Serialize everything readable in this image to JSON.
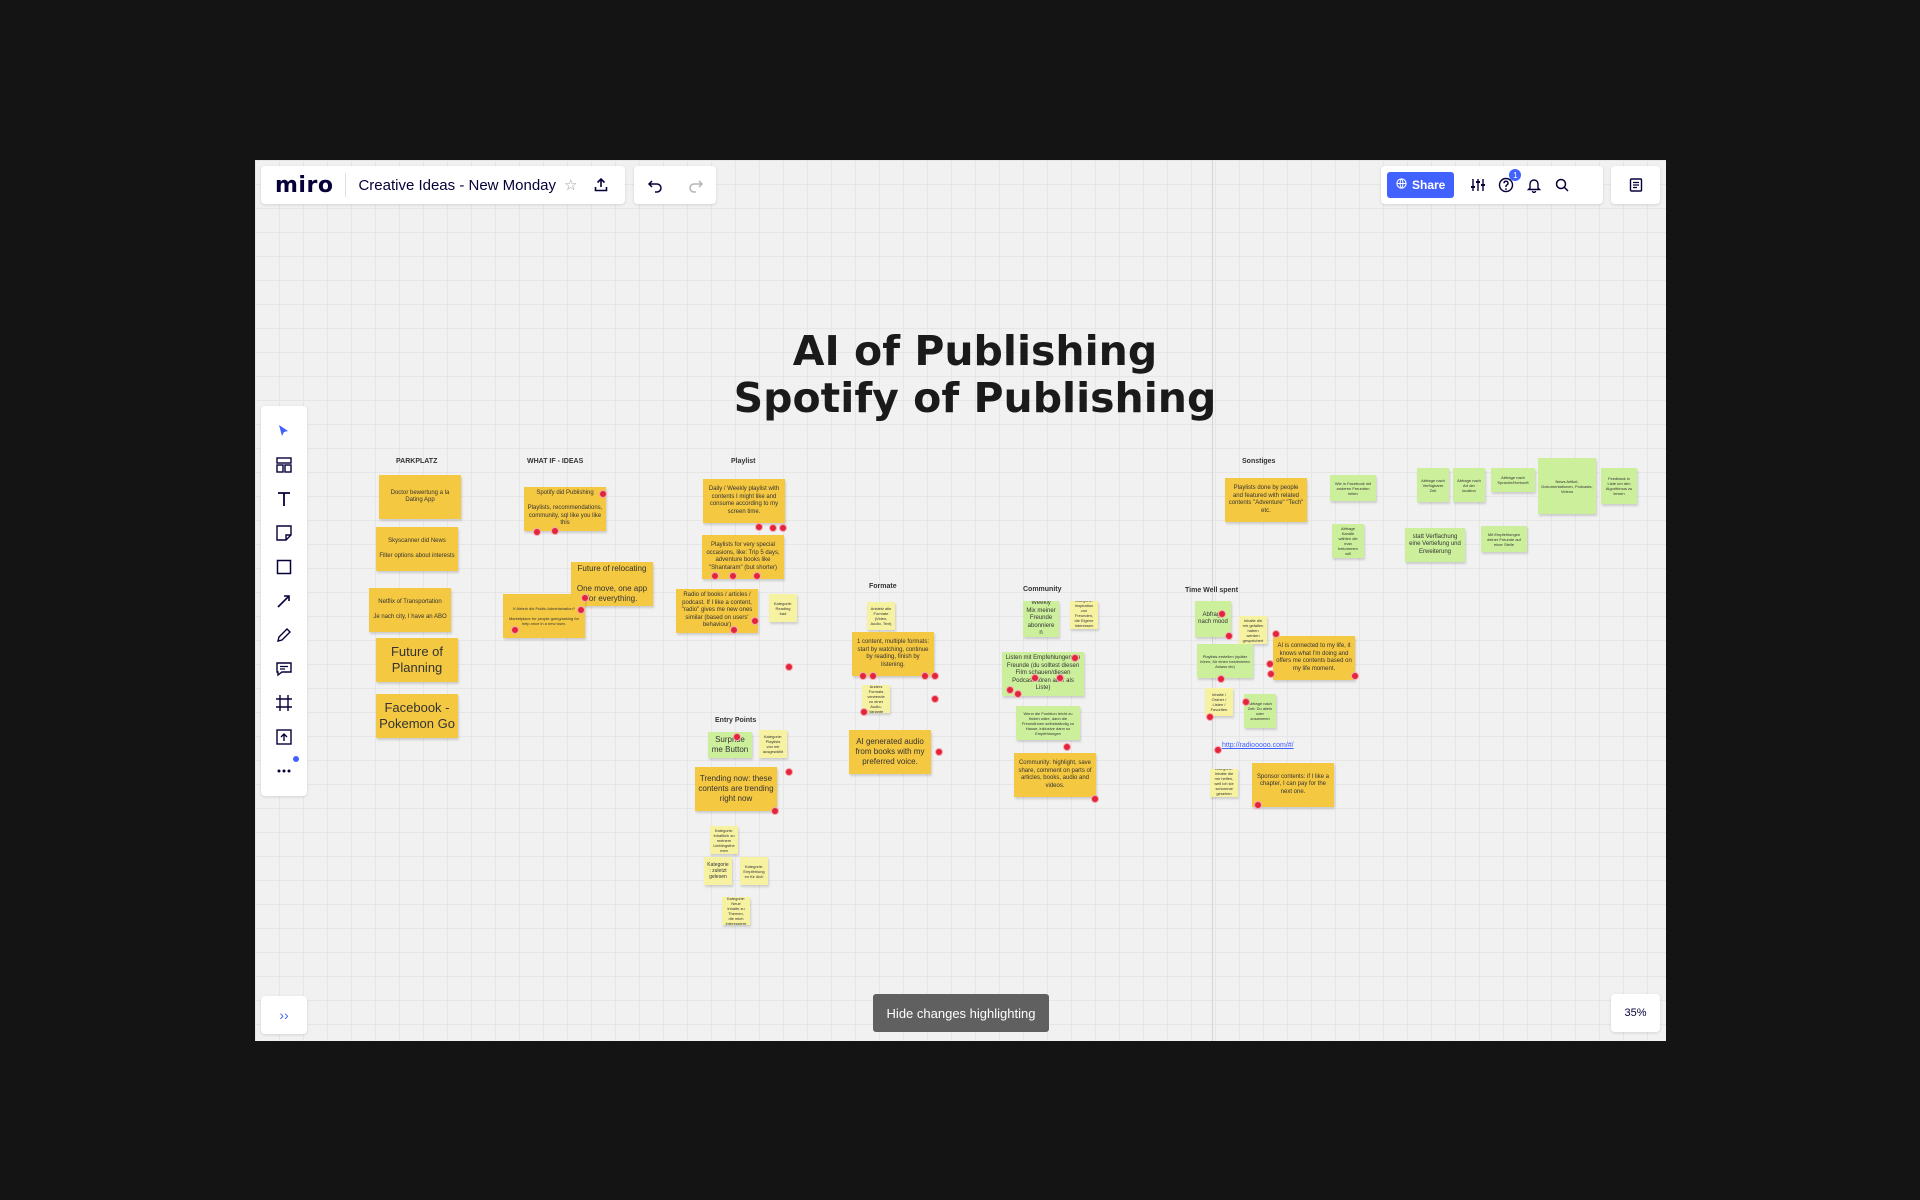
{
  "app": {
    "logo": "miro",
    "board_title": "Creative Ideas - New Monday"
  },
  "header": {
    "share_label": "Share",
    "help_badge": "1"
  },
  "canvas": {
    "title_line1": "AI of Publishing",
    "title_line2": "Spotify of Publishing",
    "headings": {
      "parkplatz": "PARKPLATZ",
      "whatif": "WHAT IF - IDEAS",
      "playlist": "Playlist",
      "formate": "Formate",
      "community": "Community",
      "timewell": "Time Well spent",
      "entry": "Entry Points",
      "sonstiges": "Sonstiges"
    },
    "notes": {
      "p1": "Doctor bewertung a la Dating App",
      "p2": "Skyscanner did News\n\nFilter options about interests",
      "p3": "Netflix of Transportation\n\nJe nach city, I have an ABO",
      "p4": "Future of Planning",
      "p5": "Facebook - Pokemon Go",
      "w1": "Spotify did Publishing\n\nPlaylists, recommendations, community, sql like you like this",
      "w2": "Future of relocating\n\nOne move, one app for everything.",
      "w3": "If Airbnb did Public Administration?\n\nMarketplace for people going/asking for help once in a new town.",
      "pl1": "Daily / Weekly playlist with contents I might like and consume according to my screen time.",
      "pl2": "Playlists for very special occasions, like: Trip 5 days, adventure books like \"Shantaram\" (but shorter)",
      "pl3": "Radio of books / articles / podcast. If I like a content, \"radio\" gives me new ones similar (based on users' behaviour)",
      "pl4": "Kategorie: Reading bad",
      "f1": "Anbietz alle Formate (Video, Audio, Text)",
      "f2": "1 content, multiple formats: start by watching, continue by reading, finish by listening.",
      "f3": "Anders Formats verwende zu einer Audio-Variante",
      "f4": "AI generated audio from books with my preferred voice.",
      "c1": "Weekly Mix meiner Freunde abonniere n",
      "c2": "Kategorie: Inspiration von Freunden, die Eigene Interessen teilen",
      "c3": "Listen mit Empfehlungen an Freunde (du solltest diesen Film schauen/diesen Podcast hören aber als Liste)",
      "c4": "Wenn die Funktion leicht zu finden wäre, dann die Freundinnen selbstständig zu Hause, inklusive dann so Empfehlungen",
      "c5": "Community: highlight, save share, comment on parts of articles, books, audio and videos.",
      "e1": "Surprise me Button",
      "e2": "Kategorie: Playlists von mir ausgewählt",
      "e3": "Trending now: these contents are trending right now",
      "e4": "Kategorie: Inhaltlich zu meinem Lieblingsthemen",
      "e5": "Kategorie: zuletzt gelesen",
      "e6": "Kategorie: Empfehlungen für dich",
      "e7": "Inhalt / Kategorie: Neue Inhalte zu Themen, die mich interessieren",
      "t1": "Abfrage nach mood",
      "t2": "Inhalte die mir gefallen haben werden gespeichert",
      "t3": "Playlists erstellen (später hören, für einen bestimmten Anlass etc)",
      "t4": "AI is connected to my life, it knows what I'm doing and offers me contents based on my life moment.",
      "t5": "Inhalte / Ordner / Listen / Favoriten",
      "t6": "Abfrage nach Zeit: Du allein oder zusammen",
      "t7": "Kategorie: Inhalte die mir helfen, weil ich sie schonmal gesehen habe",
      "t8": "Sponsor contents: if I like a chapter, I can pay for the next one.",
      "t_link": "http://radiooooo.com/#/",
      "s1": "Playlists done by people and featured with related contents \"Adventure\" \"Tech\" etc.",
      "s2": "Wie in Facebook mit anderen Freunden teilen",
      "s3": "Abfrage nach Verfügbarer Zeit",
      "s4": "Abfrage nach Art der location",
      "s5": "Abfrage nach Sprache/Herkunft",
      "s6": "News Artikel, Dokumentationen, Podcasts, Videos",
      "s7": "Feedback in Liste um den Algorithmus zu lernen",
      "s8": "Abfrage Kanäle wählen die man bekommen will",
      "s9": "statt Verflachung eine Vertiefung und Erweiterung",
      "s10": "Mit Empfehlungen deiner Freunde auf einer Stelle"
    }
  },
  "footer": {
    "hide_highlight": "Hide changes highlighting",
    "zoom": "35%"
  },
  "colors": {
    "accent": "#4262ff",
    "sticky_yellow": "#f5c842",
    "sticky_green": "#ccef9c",
    "sticky_light": "#f6f2a1",
    "vote_dot": "#e3243b"
  },
  "icons": {
    "export": "upload-icon",
    "undo": "undo-icon",
    "redo": "redo-icon",
    "share": "globe-icon",
    "settings": "sliders-icon",
    "help": "help-icon",
    "notifications": "bell-icon",
    "search": "search-icon",
    "board_menu": "board-icon"
  }
}
